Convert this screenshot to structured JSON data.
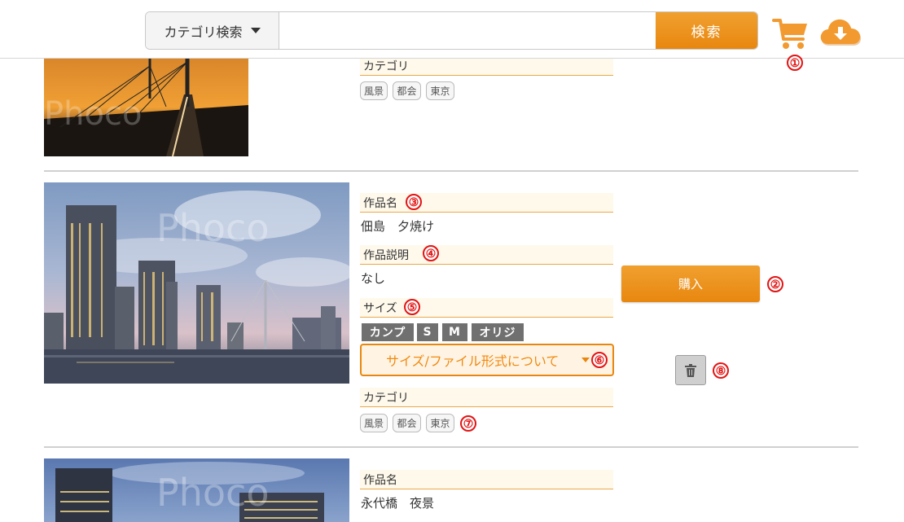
{
  "header": {
    "category_select_label": "カテゴリ検索",
    "search_value": "",
    "search_button_label": "検索",
    "cart_icon": "shopping-cart-icon",
    "download_icon": "cloud-download-icon"
  },
  "markers": [
    "①",
    "②",
    "③",
    "④",
    "⑤",
    "⑥",
    "⑦",
    "⑧"
  ],
  "labels": {
    "title": "作品名",
    "description": "作品説明",
    "size": "サイズ",
    "category": "カテゴリ"
  },
  "items": [
    {
      "category_tags": [
        "風景",
        "都会",
        "東京"
      ],
      "watermark": "Phoco"
    },
    {
      "title": "佃島　夕焼け",
      "description": "なし",
      "sizes": [
        "カンプ",
        "S",
        "M",
        "オリジ"
      ],
      "size_select_label": "サイズ/ファイル形式について",
      "buy_label": "購入",
      "category_tags": [
        "風景",
        "都会",
        "東京"
      ],
      "watermark": "Phoco"
    },
    {
      "title": "永代橋　夜景",
      "watermark": "Phoco"
    }
  ],
  "colors": {
    "accent": "#e8870f",
    "marker": "#e21414",
    "field_header_bg": "#fff9ec"
  }
}
